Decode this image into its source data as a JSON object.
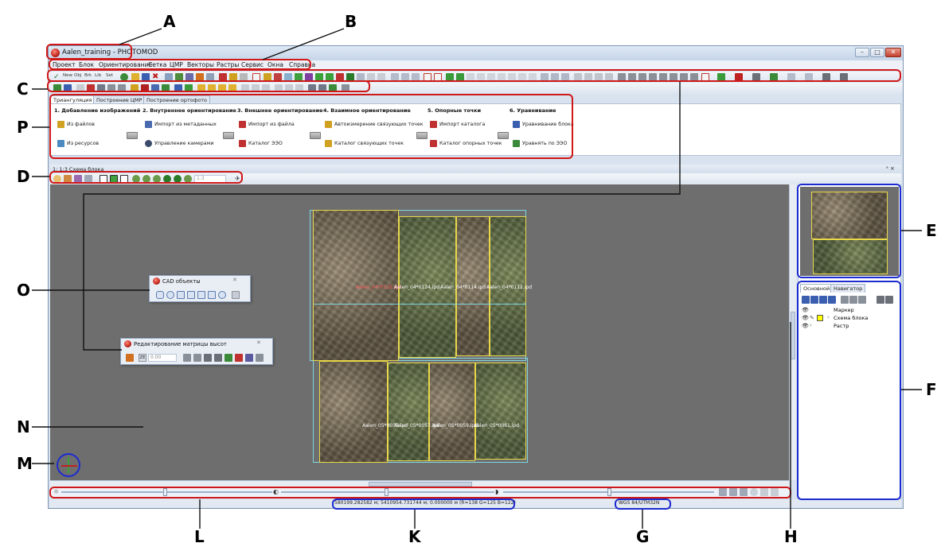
{
  "window": {
    "title": "Aalen_training - PHOTOMOD",
    "minimize": "–",
    "maximize": "□",
    "close": "✕"
  },
  "menu": [
    "Проект",
    "Блок",
    "Ориентирование",
    "Сетка",
    "ЦМР",
    "Векторы",
    "Растры",
    "Сервис",
    "Окна",
    "Справка"
  ],
  "toolbar_text": {
    "new": "New",
    "obj": "Obj",
    "brk": "Brk",
    "lib": "Lib",
    "set": "Set"
  },
  "tabs": [
    "Триангуляция",
    "Построение ЦМР",
    "Построение ортофото"
  ],
  "ribbon": {
    "steps": [
      {
        "title": "1. Добавление изображений",
        "links": [
          "Из файлов",
          "Из ресурсов"
        ]
      },
      {
        "title": "2. Внутреннее ориентирование",
        "links": [
          "Импорт из метаданных",
          "Управление камерами"
        ]
      },
      {
        "title": "3. Внешнее ориентирование",
        "links": [
          "Импорт из файла",
          "Каталог ЭЭО"
        ]
      },
      {
        "title": "4. Взаимное ориентирование",
        "links": [
          "Автоизмерение связующих точек",
          "Каталог связующих точек"
        ]
      },
      {
        "title": "5. Опорные точки",
        "links": [
          "Импорт каталога",
          "Каталог опорных точек"
        ]
      },
      {
        "title": "6. Уравнивание",
        "links": [
          "Уравнивание блока",
          "Уравнять по ЭЭО"
        ]
      }
    ]
  },
  "document": {
    "title": "1: 1:3 Схема блока",
    "zoom_value": "1:3",
    "window_controls": "ᵃ ×"
  },
  "cad_panel": {
    "title": "CAD объекты"
  },
  "dem_panel": {
    "title": "Редактирование матрицы высот",
    "value": "0.00",
    "z_label": "ZE"
  },
  "image_labels": {
    "row1": [
      "Aalen_04*0126.ipd",
      "Aalen_04*0124.ipd",
      "Aalen_04*0114.ipd",
      "Aalen_04*0112.ipd"
    ],
    "row2": [
      "Aalen_05*0055.ipd",
      "Aalen_05*0057.ipd",
      "Aalen_05*0059.ipd",
      "Aalen_05*0061.ipd"
    ]
  },
  "right_panel": {
    "tabs": [
      "Основной",
      "Навигатор"
    ],
    "layers": [
      "Маркер",
      "Схема блока",
      "Растр"
    ]
  },
  "status": {
    "coords": "580199.282582 м; 5410954.731744 м; 0.000000 м  (R=138 G=125 B=122)",
    "crs": "WGS 84/UTM32N"
  },
  "annotations": [
    "A",
    "B",
    "C",
    "P",
    "D",
    "E",
    "O",
    "F",
    "N",
    "M",
    "L",
    "K",
    "G",
    "H"
  ],
  "colors": {
    "red_box": "#d01818",
    "blue_box": "#1c2bd0",
    "viewport": "#6e6e6e",
    "image_outline": "#e8d84a",
    "block_outline": "#7fd6e0"
  }
}
